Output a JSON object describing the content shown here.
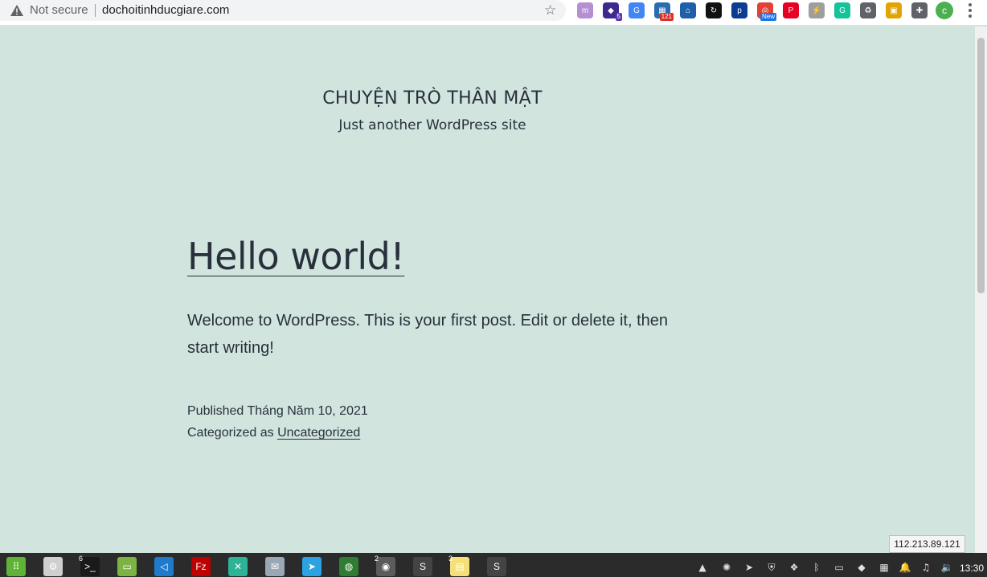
{
  "browser": {
    "security_label": "Not secure",
    "url": "dochoitinhducgiare.com",
    "extensions": [
      {
        "name": "extension-1-icon",
        "color": "#b58fd1",
        "glyph": "m",
        "badge": ""
      },
      {
        "name": "extension-2-icon",
        "color": "#3d2a8e",
        "glyph": "◆",
        "badge": "5"
      },
      {
        "name": "google-translate-icon",
        "color": "#4285f4",
        "glyph": "G",
        "badge": ""
      },
      {
        "name": "extension-4-icon",
        "color": "#2b6cb0",
        "glyph": "▦",
        "badge": "121"
      },
      {
        "name": "extension-5-icon",
        "color": "#1e5fa8",
        "glyph": "⌂",
        "badge": ""
      },
      {
        "name": "sync-icon",
        "color": "#111111",
        "glyph": "↻",
        "badge": ""
      },
      {
        "name": "extension-7-icon",
        "color": "#0b3d91",
        "glyph": "p",
        "badge": ""
      },
      {
        "name": "extension-8-icon",
        "color": "#e34133",
        "glyph": "◎",
        "badge": "New"
      },
      {
        "name": "pinterest-icon",
        "color": "#e60023",
        "glyph": "P",
        "badge": ""
      },
      {
        "name": "lightning-icon",
        "color": "#9e9e9e",
        "glyph": "⚡",
        "badge": ""
      },
      {
        "name": "grammarly-icon",
        "color": "#15c39a",
        "glyph": "G",
        "badge": ""
      },
      {
        "name": "recycle-icon",
        "color": "#5f6368",
        "glyph": "♻",
        "badge": ""
      },
      {
        "name": "extension-13-icon",
        "color": "#e2a400",
        "glyph": "▣",
        "badge": ""
      },
      {
        "name": "extensions-puzzle-icon",
        "color": "#5f6368",
        "glyph": "✚",
        "badge": ""
      }
    ],
    "profile_initial": "c"
  },
  "site": {
    "title": "CHUYỆN TRÒ THÂN MẬT",
    "tagline": "Just another WordPress site"
  },
  "post": {
    "title": "Hello world!",
    "body": "Welcome to WordPress. This is your first post. Edit or delete it, then start writing!",
    "published_label": "Published",
    "published_date": "Tháng Năm 10, 2021",
    "categorized_label": "Categorized as",
    "category": "Uncategorized"
  },
  "status": {
    "ip": "112.213.89.121"
  },
  "taskbar": {
    "apps": [
      {
        "name": "app-menu-icon",
        "color": "#5fb336",
        "glyph": "⠿",
        "count": ""
      },
      {
        "name": "settings-icon",
        "color": "#cfcfcf",
        "glyph": "⚙",
        "count": ""
      },
      {
        "name": "terminal-icon",
        "color": "#1a1a1a",
        "glyph": ">_",
        "count": "6"
      },
      {
        "name": "files-icon",
        "color": "#7cb342",
        "glyph": "▭",
        "count": ""
      },
      {
        "name": "vscode-icon",
        "color": "#1f7acc",
        "glyph": "◁",
        "count": ""
      },
      {
        "name": "filezilla-icon",
        "color": "#bf0000",
        "glyph": "Fz",
        "count": ""
      },
      {
        "name": "extension-app-icon",
        "color": "#2eb398",
        "glyph": "✕",
        "count": ""
      },
      {
        "name": "mail-icon",
        "color": "#9aa7b5",
        "glyph": "✉",
        "count": ""
      },
      {
        "name": "telegram-icon",
        "color": "#2aa3e0",
        "glyph": "➤",
        "count": ""
      },
      {
        "name": "globe-icon",
        "color": "#2e7d32",
        "glyph": "◍",
        "count": ""
      },
      {
        "name": "chrome-icon",
        "color": "#5b5b5b",
        "glyph": "◉",
        "count": "2"
      },
      {
        "name": "sublime-icon",
        "color": "#444444",
        "glyph": "S",
        "count": ""
      },
      {
        "name": "notes-icon",
        "color": "#f4df7a",
        "glyph": "▤",
        "count": "3"
      },
      {
        "name": "sublime-2-icon",
        "color": "#444444",
        "glyph": "S",
        "count": ""
      }
    ],
    "tray": [
      {
        "name": "tray-1-icon",
        "glyph": "▲"
      },
      {
        "name": "tray-2-icon",
        "glyph": "✺"
      },
      {
        "name": "tray-send-icon",
        "glyph": "➤"
      },
      {
        "name": "tray-shield-icon",
        "glyph": "⛨"
      },
      {
        "name": "dropbox-icon",
        "glyph": "❖"
      },
      {
        "name": "bluetooth-icon",
        "glyph": "ᛒ"
      },
      {
        "name": "tray-notes-icon",
        "glyph": "▭"
      },
      {
        "name": "anydesk-icon",
        "glyph": "◆"
      },
      {
        "name": "tray-grid-icon",
        "glyph": "▦"
      },
      {
        "name": "notification-icon",
        "glyph": "🔔"
      },
      {
        "name": "music-icon",
        "glyph": "♫"
      },
      {
        "name": "volume-icon",
        "glyph": "🔉"
      }
    ],
    "clock": "13:30"
  }
}
